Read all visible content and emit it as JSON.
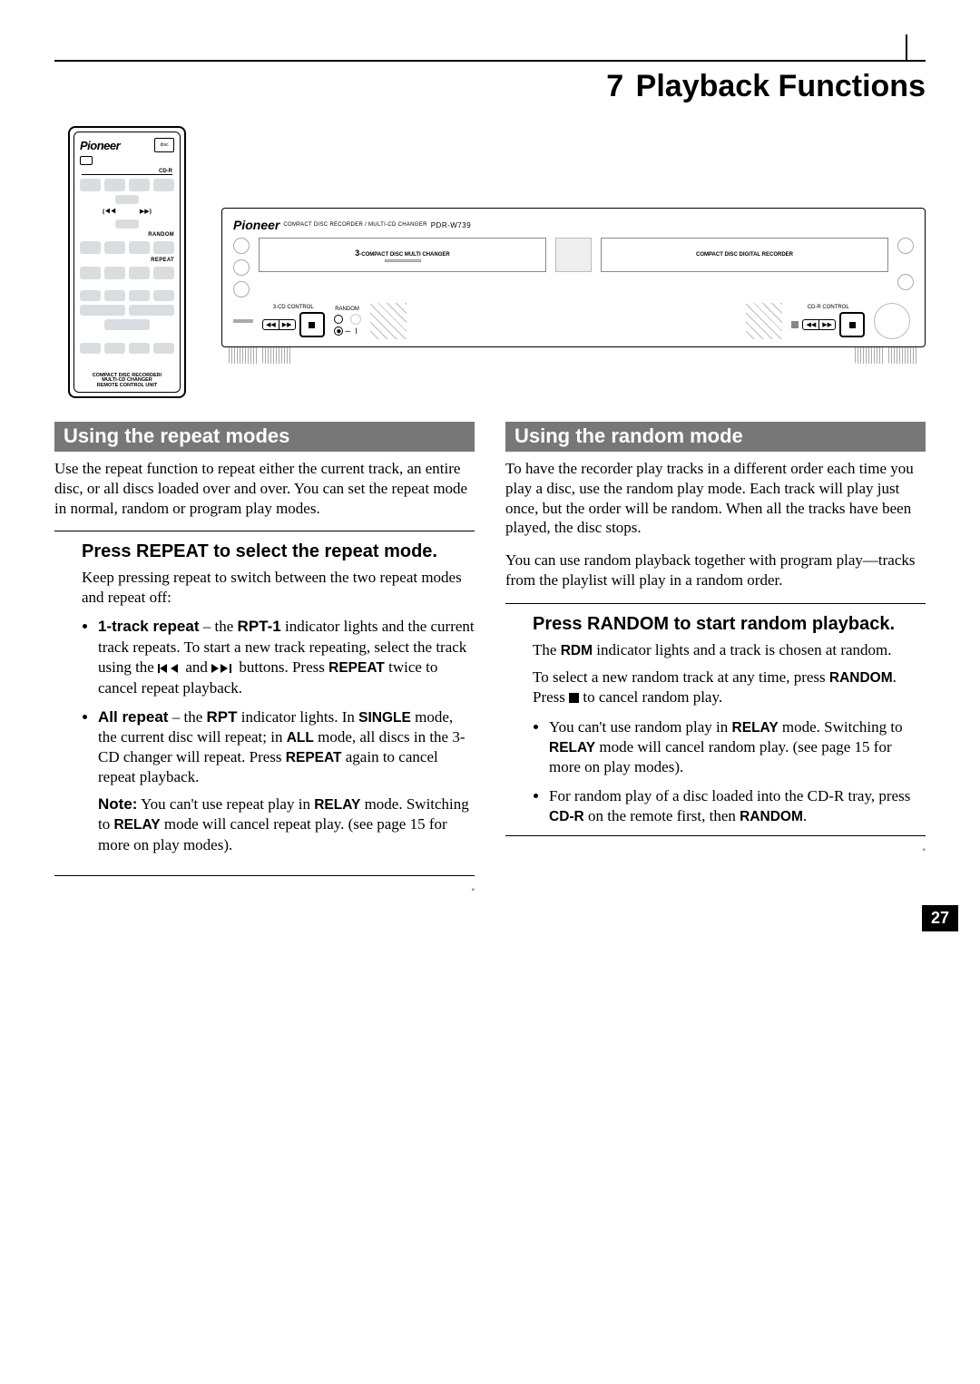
{
  "header": {
    "chapter_num": "7",
    "chapter_title": "Playback Functions"
  },
  "remote": {
    "brand": "Pioneer",
    "cdr_tag": "CD-R",
    "random_label": "RANDOM",
    "repeat_label": "REPEAT",
    "footer_l1": "COMPACT DISC RECORDER/",
    "footer_l2": "MULTI-CD CHANGER",
    "footer_l3": "REMOTE CONTROL UNIT"
  },
  "panel": {
    "brand": "Pioneer",
    "subtitle": "COMPACT DISC RECORDER / MULTI-CD CHANGER",
    "model": "PDR-W739",
    "tray_left_prefix": "3",
    "tray_left_label": "-COMPACT DISC MULTI CHANGER",
    "tray_right_label": "COMPACT DISC DIGITAL RECORDER",
    "ctrl_left": "3-CD CONTROL",
    "random_label": "RANDOM",
    "ctrl_right": "CD-R CONTROL"
  },
  "left": {
    "heading": "Using the repeat modes",
    "intro": "Use the repeat function to repeat either the current track, an entire disc, or all discs loaded over and over. You can set the repeat mode in normal, random or program play modes.",
    "step_title": "Press REPEAT to select the repeat mode.",
    "step_body": "Keep pressing repeat to switch between the two repeat modes and repeat off:",
    "b1_strong": "1-track repeat",
    "b1_a": " – the ",
    "b1_rpt1": "RPT-1",
    "b1_b": " indicator lights and the current track repeats. To start a new track repeating, select the track using the ",
    "b1_c": " and ",
    "b1_d": " buttons. Press ",
    "b1_repeat": "REPEAT",
    "b1_e": " twice to cancel repeat playback.",
    "b2_strong": "All repeat",
    "b2_a": " – the ",
    "b2_rpt": "RPT",
    "b2_b": " indicator lights. In ",
    "b2_single": "SINGLE",
    "b2_c": " mode, the current disc will repeat; in ",
    "b2_all": "ALL",
    "b2_d": " mode, all discs in the 3-CD changer will repeat. Press ",
    "b2_repeat": "REPEAT",
    "b2_e": " again to cancel repeat playback.",
    "note_label": "Note:",
    "note_a": " You can't use repeat play in ",
    "note_relay": "RELAY",
    "note_b": " mode. Switching to ",
    "note_c": " mode will cancel repeat play. (see page 15 for more on play modes)."
  },
  "right": {
    "heading": "Using the random mode",
    "intro": "To have the recorder play tracks in a different order each time you play a disc, use the random play mode. Each track will play just once, but the order will be random. When all the tracks have been played, the disc stops.",
    "intro2": "You can use random playback together with program play—tracks from the playlist will play in a random order.",
    "step_title": "Press RANDOM to start random playback.",
    "step_a": "The ",
    "step_rdm": "RDM",
    "step_b": " indicator lights and a track is chosen at random.",
    "step_c": "To select a new random track at any time, press ",
    "step_random": "RANDOM",
    "step_d": ". Press ",
    "step_e": " to cancel random play.",
    "b1_a": "You can't use random play in ",
    "b1_relay": "RELAY",
    "b1_b": " mode. Switching to ",
    "b1_c": " mode will cancel random play. (see page 15 for more on play modes).",
    "b2_a": "For random play of a disc loaded into the CD-R tray, press ",
    "b2_cdr": "CD-R",
    "b2_b": " on the remote first, then ",
    "b2_random": "RANDOM",
    "b2_c": "."
  },
  "page_number": "27"
}
